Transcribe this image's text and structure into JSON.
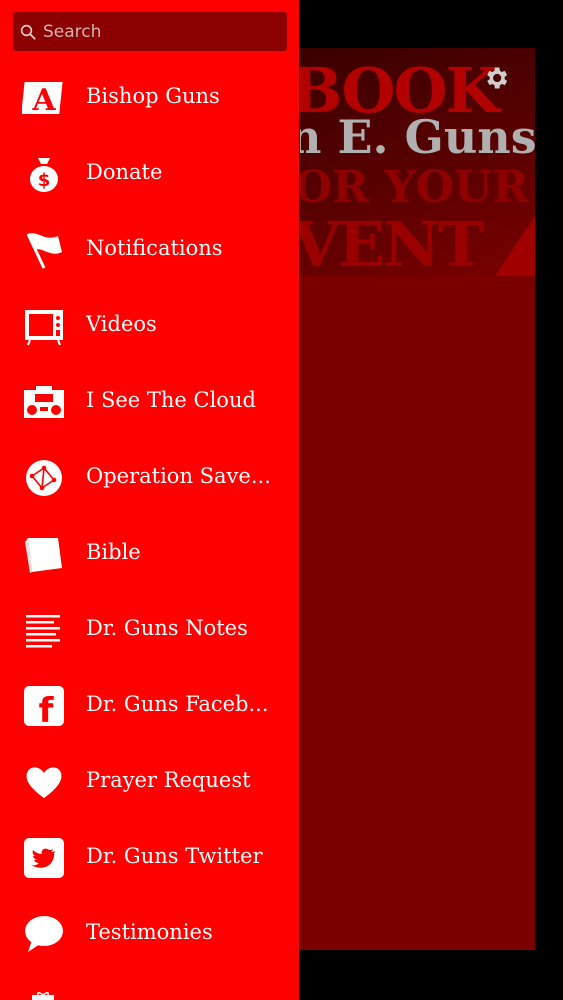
{
  "search": {
    "placeholder": "Search"
  },
  "banner": {
    "line1": "BOOK",
    "line2": "n E. Guns",
    "line3": "OR YOUR",
    "line4": "VENT"
  },
  "menu": {
    "items": [
      {
        "label": "Bishop Guns",
        "icon": "letter-a-icon"
      },
      {
        "label": "Donate",
        "icon": "money-bag-icon"
      },
      {
        "label": "Notifications",
        "icon": "flag-icon"
      },
      {
        "label": "Videos",
        "icon": "tv-icon"
      },
      {
        "label": "I See The Cloud",
        "icon": "radio-icon"
      },
      {
        "label": "Operation Save...",
        "icon": "network-globe-icon"
      },
      {
        "label": "Bible",
        "icon": "book-icon"
      },
      {
        "label": "Dr. Guns Notes",
        "icon": "text-lines-icon"
      },
      {
        "label": "Dr. Guns Faceb...",
        "icon": "facebook-icon"
      },
      {
        "label": "Prayer Request",
        "icon": "heart-icon"
      },
      {
        "label": "Dr. Guns Twitter",
        "icon": "twitter-icon"
      },
      {
        "label": "Testimonies",
        "icon": "speech-bubble-icon"
      }
    ]
  },
  "colors": {
    "drawer": "#ff0000",
    "search_bg": "#8b0000",
    "panel": "#7a0000"
  }
}
